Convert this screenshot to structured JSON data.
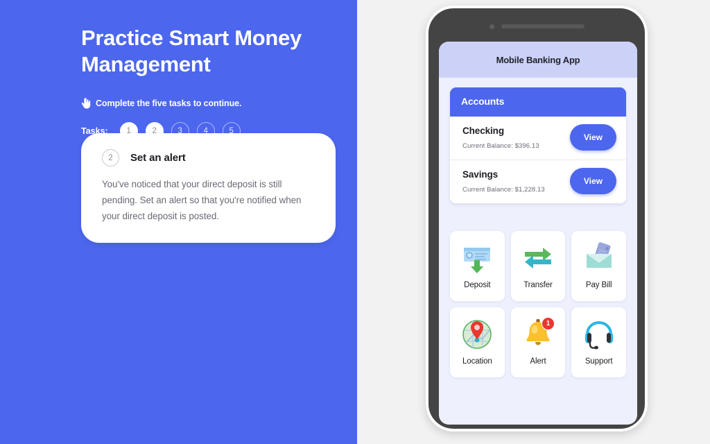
{
  "left": {
    "headline": "Practice Smart Money Management",
    "hand_icon": "pointing-hand-icon",
    "instruction": "Complete the five tasks to continue.",
    "tasks_label": "Tasks:",
    "steps": [
      {
        "number": "1",
        "state": "done"
      },
      {
        "number": "2",
        "state": "done"
      },
      {
        "number": "3",
        "state": "todo"
      },
      {
        "number": "4",
        "state": "todo"
      },
      {
        "number": "5",
        "state": "todo"
      }
    ],
    "task_card": {
      "number": "2",
      "title": "Set an alert",
      "body": "You've noticed that your direct deposit is still pending. Set an alert so that you're notified when your direct deposit is posted."
    }
  },
  "phone": {
    "app_title": "Mobile Banking App",
    "accounts": {
      "header": "Accounts",
      "rows": [
        {
          "name": "Checking",
          "balance": "Current Balance: $396.13",
          "action": "View"
        },
        {
          "name": "Savings",
          "balance": "Current Balance: $1,228.13",
          "action": "View"
        }
      ]
    },
    "tiles": [
      {
        "label": "Deposit",
        "icon": "check-deposit-icon",
        "badge": ""
      },
      {
        "label": "Transfer",
        "icon": "transfer-arrows-icon",
        "badge": ""
      },
      {
        "label": "Pay Bill",
        "icon": "envelope-bill-icon",
        "badge": ""
      },
      {
        "label": "Location",
        "icon": "map-pin-icon",
        "badge": ""
      },
      {
        "label": "Alert",
        "icon": "bell-icon",
        "badge": "1"
      },
      {
        "label": "Support",
        "icon": "headset-icon",
        "badge": ""
      }
    ]
  },
  "colors": {
    "brand_blue": "#4c66ed",
    "page_gray": "#f2f2f2",
    "screen_bg": "#eef0fd",
    "app_header": "#ccd2f7",
    "badge_red": "#e8382f"
  }
}
